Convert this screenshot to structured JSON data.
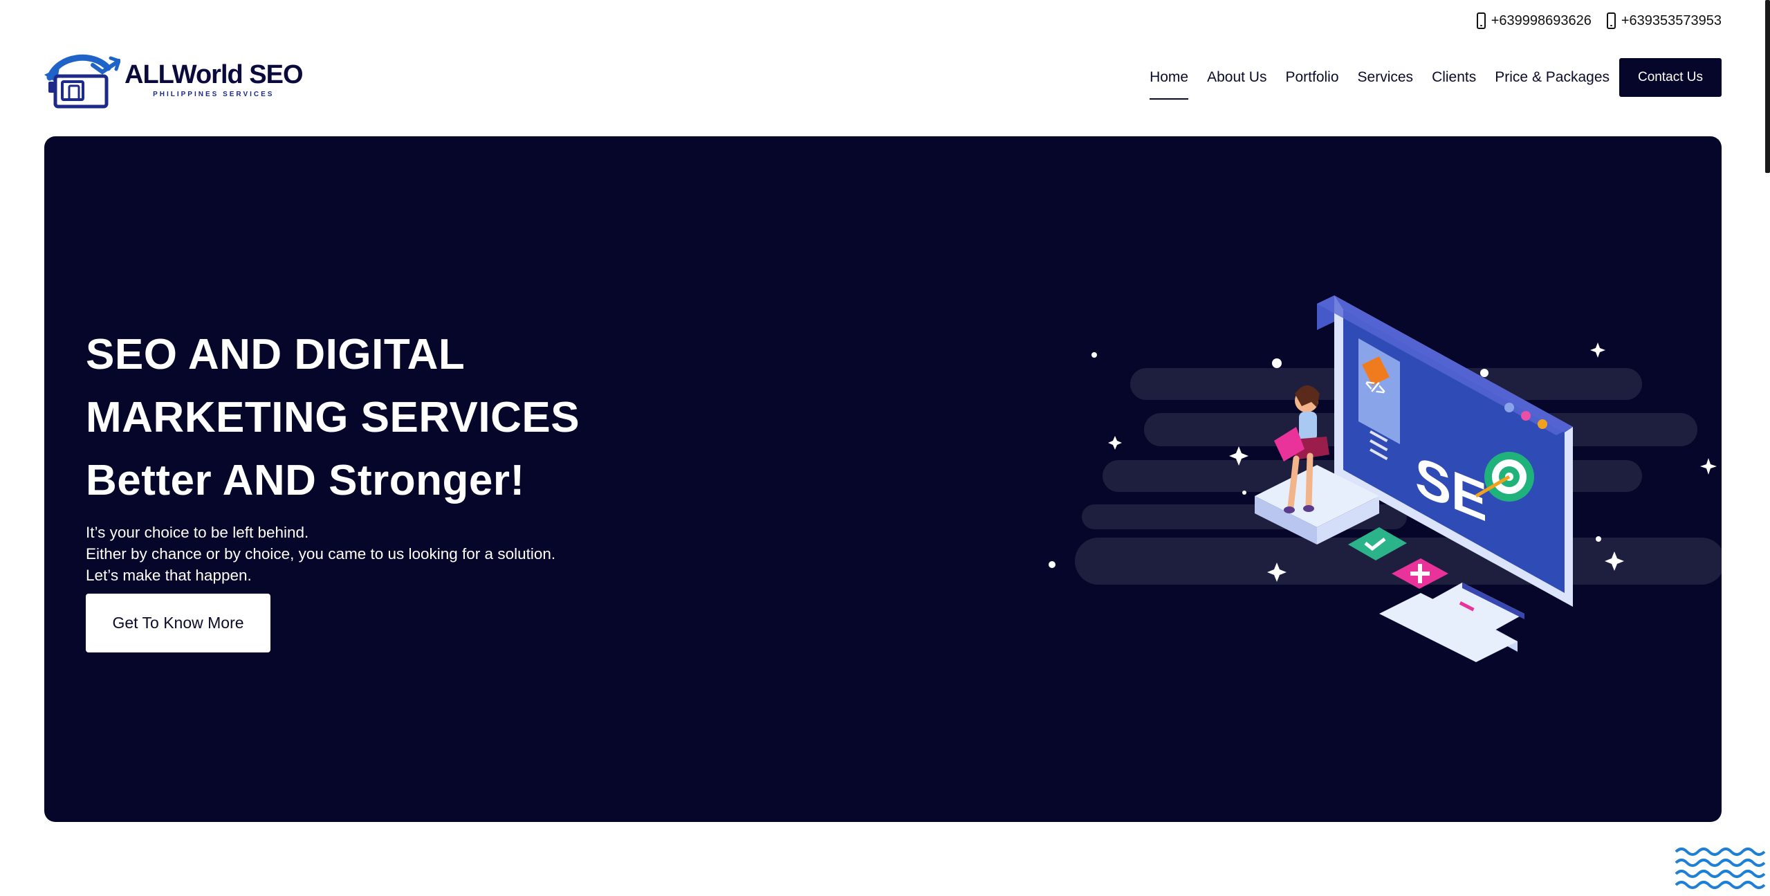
{
  "contacts": [
    {
      "phone": "+639998693626"
    },
    {
      "phone": "+639353573953"
    }
  ],
  "logo": {
    "name": "ALLWorld SEO",
    "tagline": "PHILIPPINES SERVICES"
  },
  "nav": {
    "items": [
      {
        "label": "Home",
        "active": true
      },
      {
        "label": "About Us"
      },
      {
        "label": "Portfolio"
      },
      {
        "label": "Services"
      },
      {
        "label": "Clients"
      },
      {
        "label": "Price & Packages"
      }
    ],
    "cta": "Contact Us"
  },
  "hero": {
    "title_lines": [
      "SEO AND DIGITAL",
      "MARKETING SERVICES",
      "Better AND Stronger!"
    ],
    "subtitle_lines": [
      "It’s your choice to be left behind.",
      "Either by chance or by choice, you came to us looking for a solution.",
      "Let’s make that happen."
    ],
    "button": "Get To Know More",
    "illustration_text": "SE"
  },
  "colors": {
    "navy": "#06062a",
    "accent_blue": "#2f4bb5",
    "wave": "#1e7fd6"
  }
}
